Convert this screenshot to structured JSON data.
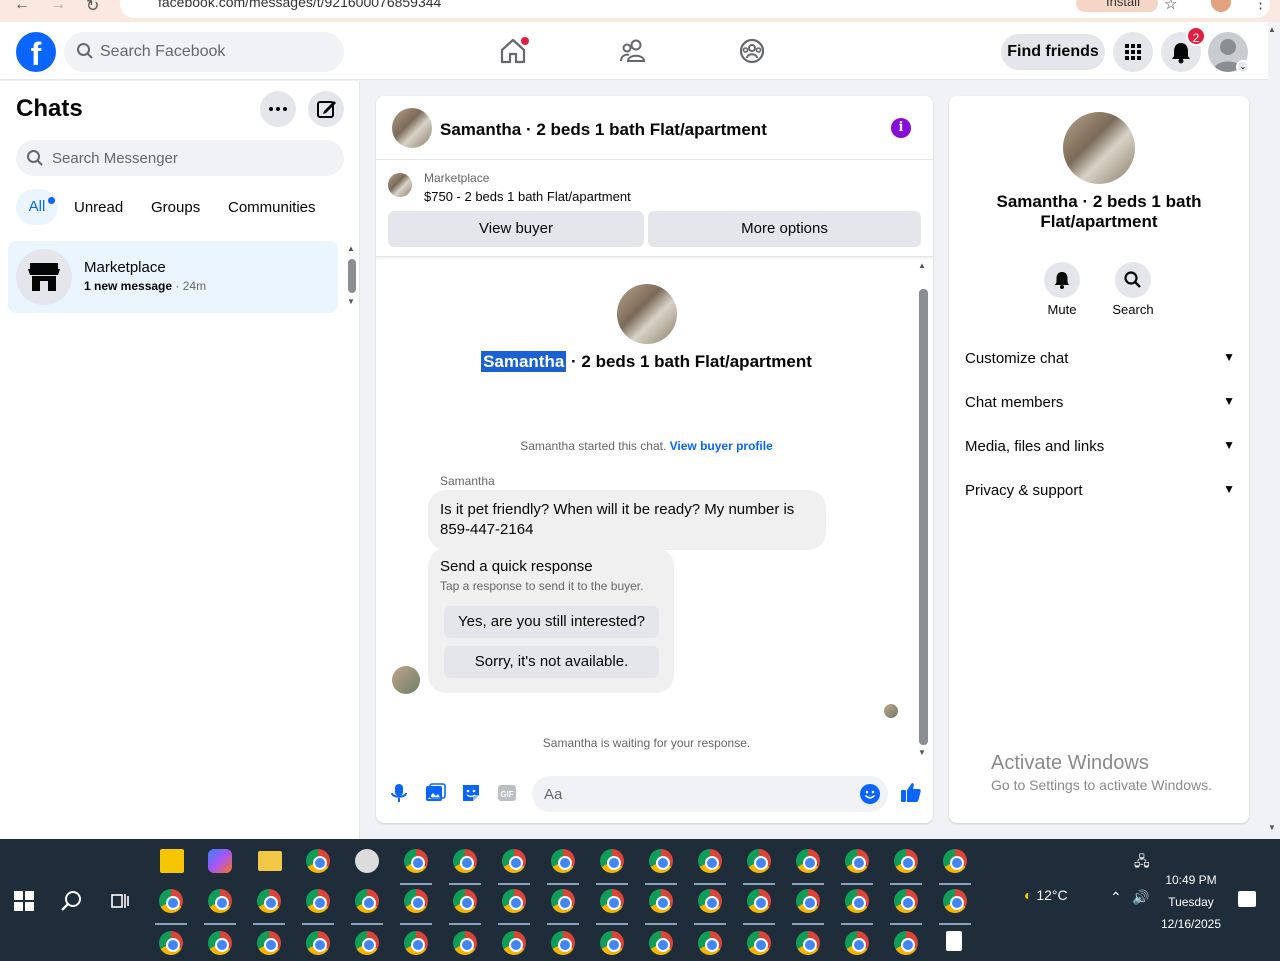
{
  "browser": {
    "url": "facebook.com/messages/t/921600076859344",
    "install_label": "Install"
  },
  "header": {
    "search_placeholder": "Search Facebook",
    "find_friends_label": "Find friends",
    "notification_count": "2"
  },
  "chats": {
    "title": "Chats",
    "search_placeholder": "Search Messenger",
    "filters": [
      "All",
      "Unread",
      "Groups",
      "Communities"
    ],
    "items": [
      {
        "name": "Marketplace",
        "preview": "1 new message",
        "time": "24m"
      }
    ]
  },
  "conversation": {
    "title": "Samantha · 2 beds 1 bath Flat/apartment",
    "listing": {
      "source": "Marketplace",
      "price_line": "$750 - 2 beds 1 bath Flat/apartment",
      "view_buyer_label": "View buyer",
      "more_options_label": "More options"
    },
    "intro_name_highlight": "Samantha",
    "intro_title_rest": " · 2 beds 1 bath Flat/apartment",
    "started_text": "Samantha started this chat. ",
    "view_buyer_profile": "View buyer profile",
    "sender_name": "Samantha",
    "message": "Is it pet friendly? When will it be ready? My number is 859-447-2164",
    "quick_response": {
      "title": "Send a quick response",
      "subtitle": "Tap a response to send it to the buyer.",
      "options": [
        "Yes, are you still interested?",
        "Sorry, it's not available."
      ]
    },
    "waiting_text": "Samantha is waiting for your response.",
    "composer_placeholder": "Aa"
  },
  "info_panel": {
    "title": "Samantha · 2 beds 1 bath Flat/apartment",
    "mute_label": "Mute",
    "search_label": "Search",
    "sections": [
      "Customize chat",
      "Chat members",
      "Media, files and links",
      "Privacy & support"
    ],
    "activate_title": "Activate Windows",
    "activate_sub": "Go to Settings to activate Windows."
  },
  "taskbar": {
    "temperature": "12°C",
    "time": "10:49 PM",
    "day": "Tuesday",
    "date": "12/16/2025"
  },
  "colors": {
    "brand_blue": "#0866ff",
    "notification_red": "#e41e3f",
    "info_purple": "#8a0bd9",
    "taskbar": "#1f2c3a"
  }
}
